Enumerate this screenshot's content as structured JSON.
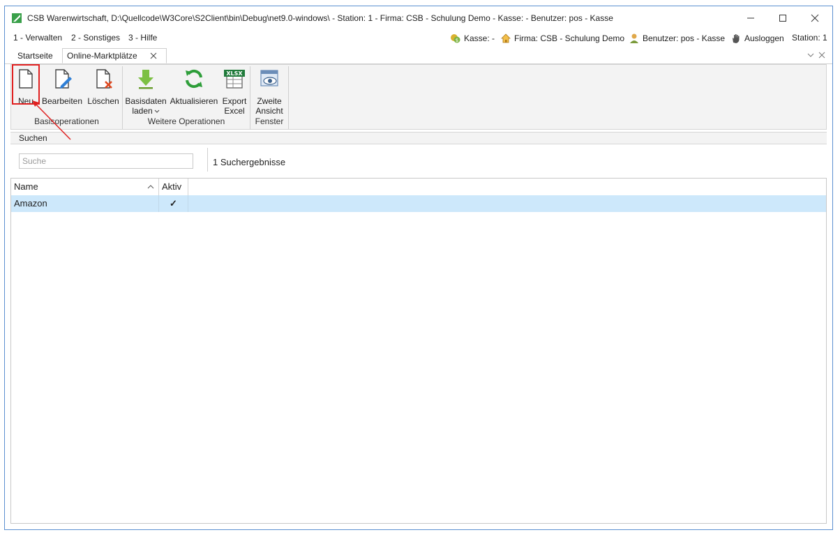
{
  "window": {
    "title": "CSB Warenwirtschaft, D:\\Quellcode\\W3Core\\S2Client\\bin\\Debug\\net9.0-windows\\ - Station: 1 - Firma: CSB - Schulung Demo - Kasse:  - Benutzer: pos - Kasse"
  },
  "menu": {
    "items": [
      {
        "label": "1 - Verwalten"
      },
      {
        "label": "2 - Sonstiges"
      },
      {
        "label": "3 - Hilfe"
      }
    ]
  },
  "status": {
    "kasse": "Kasse: -",
    "firma": "Firma: CSB - Schulung Demo",
    "benutzer": "Benutzer: pos - Kasse",
    "logout": "Ausloggen",
    "station": "Station: 1"
  },
  "tabs": [
    {
      "label": "Startseite",
      "active": false
    },
    {
      "label": "Online-Marktplätze",
      "active": true
    }
  ],
  "ribbon": {
    "buttons": [
      {
        "label": "Neu",
        "icon": "new-document-icon"
      },
      {
        "label": "Bearbeiten",
        "icon": "edit-document-icon"
      },
      {
        "label": "Löschen",
        "icon": "delete-document-icon"
      },
      {
        "label_line1": "Basisdaten",
        "label_line2": "laden",
        "icon": "download-arrow-icon"
      },
      {
        "label": "Aktualisieren",
        "icon": "refresh-icon"
      },
      {
        "label_line1": "Export",
        "label_line2": "Excel",
        "icon": "xlsx-icon"
      },
      {
        "label_line1": "Zweite",
        "label_line2": "Ansicht",
        "icon": "second-view-icon"
      }
    ],
    "groups": [
      {
        "label": "Basisoperationen"
      },
      {
        "label": "Weitere Operationen"
      },
      {
        "label": "Fenster"
      }
    ]
  },
  "search": {
    "header": "Suchen",
    "placeholder": "Suche",
    "value": "",
    "result_count": "1 Suchergebnisse"
  },
  "grid": {
    "columns": [
      {
        "label": "Name"
      },
      {
        "label": "Aktiv"
      }
    ],
    "rows": [
      {
        "name": "Amazon",
        "aktiv": "✓"
      }
    ]
  },
  "colors": {
    "accent": "#e02020",
    "selection": "#cde8fb",
    "refresh_green": "#2e9e3a",
    "download_green": "#7cc043"
  }
}
